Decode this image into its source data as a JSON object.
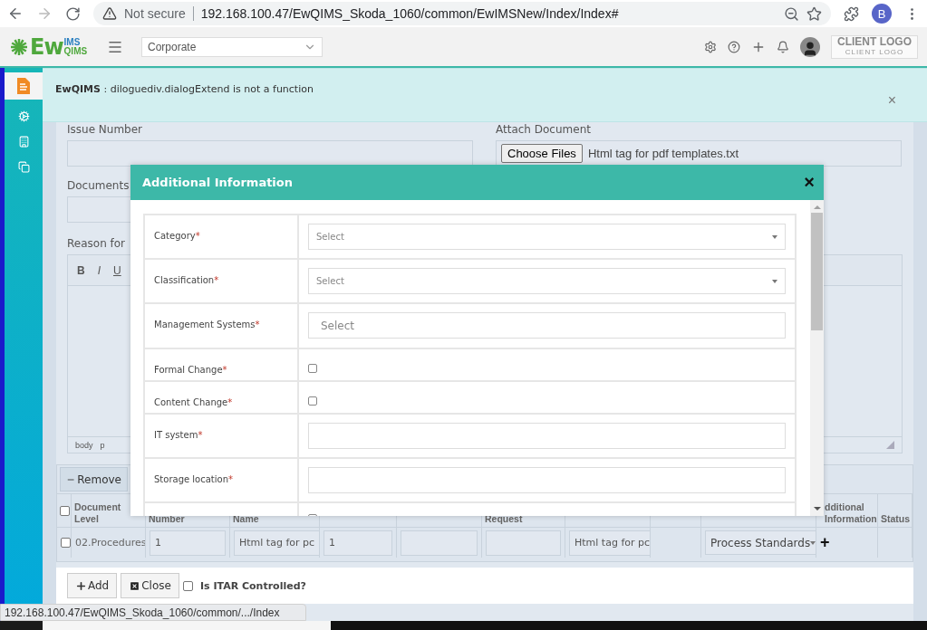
{
  "browser": {
    "security": "Not secure",
    "url": "192.168.100.47/EwQIMS_Skoda_1060/common/EwIMSNew/Index/Index#",
    "profile": "B"
  },
  "header": {
    "logo_main": "Ew",
    "logo_top": "IMS",
    "logo_bottom": "QIMS",
    "site": "Corporate",
    "client_logo": "CLIENT LOGO",
    "client_logo_sub": "CLIENT LOGO"
  },
  "sidebar": {
    "items": [
      {
        "selected": true
      },
      {
        "selected": false
      },
      {
        "selected": false
      },
      {
        "selected": false
      }
    ]
  },
  "alert": {
    "message": "**EwQIMS** : diloguediv.dialogExtend is not a function",
    "close": "×"
  },
  "form": {
    "fields": [
      {
        "label": "Issue Number",
        "kind": "text"
      },
      {
        "label": "Attach Document",
        "kind": "file",
        "button": "Choose Files",
        "value": "Html tag for pdf templates.txt"
      },
      {
        "label": "Documents",
        "kind": "text"
      }
    ],
    "editor": {
      "label": "Reason for",
      "tools": [
        {
          "label": "B",
          "kind": "bold"
        },
        {
          "label": "I",
          "kind": "italic"
        },
        {
          "label": "U",
          "kind": "underline"
        }
      ],
      "path": [
        "body",
        "p"
      ]
    }
  },
  "documents": {
    "remove": "Remove",
    "header_checked": false,
    "columns": [
      {
        "label": "Document Level"
      },
      {
        "label": "Number"
      },
      {
        "label": "Name"
      },
      {},
      {},
      {
        "label": "Request"
      },
      {},
      {},
      {},
      {
        "label": "dditional Information"
      },
      {
        "label": "Status"
      }
    ],
    "rows": [
      {
        "checked": false,
        "cells": [
          {
            "kind": "text",
            "value": "02.Procedures"
          },
          {
            "kind": "input",
            "value": "1"
          },
          {
            "kind": "input",
            "value": "Html tag for pc"
          },
          {
            "kind": "input",
            "value": "1"
          },
          {
            "kind": "input"
          },
          {
            "kind": "input"
          },
          {
            "kind": "input",
            "value": "Html tag for pc"
          },
          {
            "kind": "empty"
          },
          {
            "kind": "select",
            "value": "Process Standards"
          },
          {
            "kind": "add",
            "value": "+"
          },
          {
            "kind": "empty"
          }
        ]
      }
    ]
  },
  "footer": {
    "add": "Add",
    "close": "Close",
    "itar": {
      "label": "Is ITAR Controlled?",
      "checked": false
    }
  },
  "modal": {
    "title": "Additional Information",
    "close": "×",
    "rows": [
      {
        "label": "Category",
        "mark": "*",
        "kind": "select",
        "placeholder": "Select"
      },
      {
        "label": "Classification",
        "mark": "*",
        "kind": "select",
        "placeholder": "Select"
      },
      {
        "label": "Management Systems",
        "mark": "*",
        "kind": "multiselect",
        "placeholder": "Select"
      },
      {
        "label": "Formal Change",
        "mark": "*",
        "kind": "checkbox",
        "checked": false
      },
      {
        "label": "Content Change",
        "mark": "*",
        "kind": "checkbox",
        "checked": false
      },
      {
        "label": "IT system",
        "mark": "*",
        "kind": "text"
      },
      {
        "label": "Storage location",
        "mark": "*",
        "kind": "text"
      },
      {
        "kind": "checkbox",
        "checked": false
      }
    ]
  },
  "status_url": "192.168.100.47/EwQIMS_Skoda_1060/common/.../Index"
}
